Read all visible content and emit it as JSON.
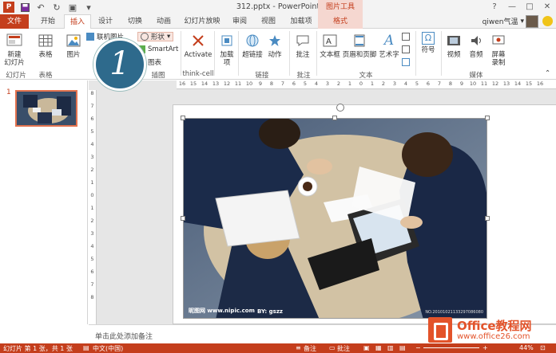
{
  "window": {
    "title": "312.pptx - PowerPoint",
    "context_group": "图片工具",
    "controls": [
      "?",
      "—",
      "□",
      "✕"
    ]
  },
  "tabs": [
    {
      "label": "文件"
    },
    {
      "label": "开始"
    },
    {
      "label": "插入"
    },
    {
      "label": "设计"
    },
    {
      "label": "切换"
    },
    {
      "label": "动画"
    },
    {
      "label": "幻灯片放映"
    },
    {
      "label": "审阅"
    },
    {
      "label": "视图"
    },
    {
      "label": "加载项"
    },
    {
      "label": "格式"
    }
  ],
  "user": {
    "name": "qiwen气温",
    "caret": "▾"
  },
  "ribbon": {
    "new_slide": "新建\n幻灯片",
    "table": "表格",
    "picture": "图片",
    "online_picture": "联机图片",
    "shapes": "形状",
    "smartart": "SmartArt",
    "chart": "图表",
    "activate": "Activate",
    "addins": "加载\n项",
    "hyperlink": "超链接",
    "action": "动作",
    "comment": "批注",
    "textbox": "文本框",
    "header_footer": "页眉和页脚",
    "wordart": "艺术字",
    "symbol": "符号",
    "video": "视频",
    "audio": "音频",
    "screen_record": "屏幕\n录制",
    "groups": {
      "slides": "幻灯片",
      "tables": "表格",
      "illustrations": "插图",
      "thinkcell": "think-cell",
      "links": "链接",
      "comments": "批注",
      "text": "文本",
      "media": "媒体"
    }
  },
  "badge": "1",
  "thumbnails": [
    {
      "number": "1"
    }
  ],
  "ruler": {
    "horizontal": [
      "16",
      "15",
      "14",
      "13",
      "12",
      "11",
      "10",
      "9",
      "8",
      "7",
      "6",
      "5",
      "4",
      "3",
      "2",
      "1",
      "0",
      "1",
      "2",
      "3",
      "4",
      "5",
      "6",
      "7",
      "8",
      "9",
      "10",
      "11",
      "12",
      "13",
      "14",
      "15",
      "16"
    ],
    "vertical": [
      "8",
      "7",
      "6",
      "5",
      "4",
      "3",
      "2",
      "1",
      "0",
      "1",
      "2",
      "3",
      "4",
      "5",
      "6",
      "7",
      "8"
    ]
  },
  "picture": {
    "watermark": "昵图网 www.nipic.com",
    "watermark2": "BY: gszz",
    "photo_id": "NO.20101021133297086080"
  },
  "notes_placeholder": "单击此处添加备注",
  "status": {
    "slide_info": "幻灯片 第 1 张，共 1 张",
    "language": "中文(中国)",
    "notes": "备注",
    "comments": "批注",
    "zoom": "44%"
  },
  "branding": {
    "name": "Office教程网",
    "url": "www.office26.com"
  },
  "colors": {
    "accent": "#c43e1c",
    "badge": "#2e6a8c",
    "logo": "#e3532a"
  }
}
